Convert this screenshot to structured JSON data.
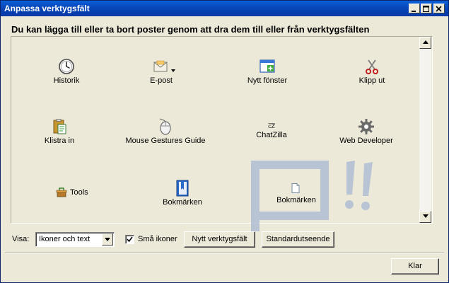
{
  "window": {
    "title": "Anpassa verktygsfält",
    "heading": "Du kan lägga till eller ta bort poster genom att dra dem till eller från verktygsfälten"
  },
  "palette": {
    "items": [
      {
        "label": "Historik",
        "icon": "history-clock-icon"
      },
      {
        "label": "E-post",
        "icon": "mail-envelope-icon"
      },
      {
        "label": "Nytt fönster",
        "icon": "new-window-icon"
      },
      {
        "label": "Klipp ut",
        "icon": "scissors-icon"
      },
      {
        "label": "Klistra in",
        "icon": "clipboard-paste-icon"
      },
      {
        "label": "Mouse Gestures Guide",
        "icon": "mouse-icon"
      },
      {
        "label": "ChatZilla",
        "icon": "chatzilla-icon"
      },
      {
        "label": "Web Developer",
        "icon": "gear-icon"
      },
      {
        "label": "Tools",
        "icon": "tools-icon"
      },
      {
        "label": "Bokmärken",
        "icon": "bookmarks-book-icon"
      }
    ],
    "dragged_item": {
      "label": "Bokmärken",
      "icon": "page-icon"
    }
  },
  "controls": {
    "show_label": "Visa:",
    "show_value": "Ikoner och text",
    "small_icons_label": "Små ikoner",
    "small_icons_checked": true,
    "new_toolbar_label": "Nytt verktygsfält",
    "default_label": "Standardutseende",
    "close_label": "Klar"
  }
}
